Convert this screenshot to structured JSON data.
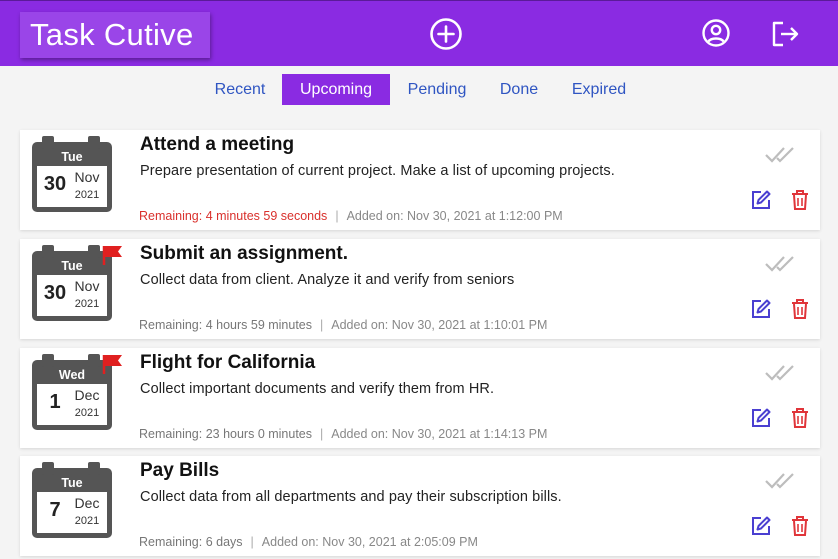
{
  "header": {
    "brand": "Task Cutive",
    "color": "#8a2be2",
    "icons": [
      "add-circle-icon",
      "account-circle-icon",
      "logout-icon"
    ]
  },
  "tabs": [
    {
      "label": "Recent",
      "active": false
    },
    {
      "label": "Upcoming",
      "active": true
    },
    {
      "label": "Pending",
      "active": false
    },
    {
      "label": "Done",
      "active": false
    },
    {
      "label": "Expired",
      "active": false
    }
  ],
  "tasks": [
    {
      "weekday": "Tue",
      "day": "30",
      "month": "Nov",
      "year": "2021",
      "flagged": false,
      "title": "Attend a meeting",
      "description": "Prepare presentation of current project. Make a list of upcoming projects.",
      "remaining": "Remaining: 4 minutes 59 seconds",
      "urgent": true,
      "added": "Added on: Nov 30, 2021 at 1:12:00 PM"
    },
    {
      "weekday": "Tue",
      "day": "30",
      "month": "Nov",
      "year": "2021",
      "flagged": true,
      "title": "Submit an assignment.",
      "description": "Collect data from client. Analyze it and verify from seniors",
      "remaining": "Remaining: 4 hours 59 minutes",
      "urgent": false,
      "added": "Added on: Nov 30, 2021 at 1:10:01 PM"
    },
    {
      "weekday": "Wed",
      "day": "1",
      "month": "Dec",
      "year": "2021",
      "flagged": true,
      "title": "Flight for California",
      "description": "Collect important documents and verify them from HR.",
      "remaining": "Remaining: 23 hours 0 minutes",
      "urgent": false,
      "added": "Added on: Nov 30, 2021 at 1:14:13 PM"
    },
    {
      "weekday": "Tue",
      "day": "7",
      "month": "Dec",
      "year": "2021",
      "flagged": false,
      "title": "Pay Bills",
      "description": "Collect data from all departments and pay their subscription bills.",
      "remaining": "Remaining: 6 days",
      "urgent": false,
      "added": "Added on: Nov 30, 2021 at 2:05:09 PM"
    }
  ],
  "colors": {
    "accent": "#8a2be2",
    "link": "#2f55c2",
    "urgent": "#d9302c",
    "edit": "#4a3fd1",
    "delete": "#e0353a"
  }
}
